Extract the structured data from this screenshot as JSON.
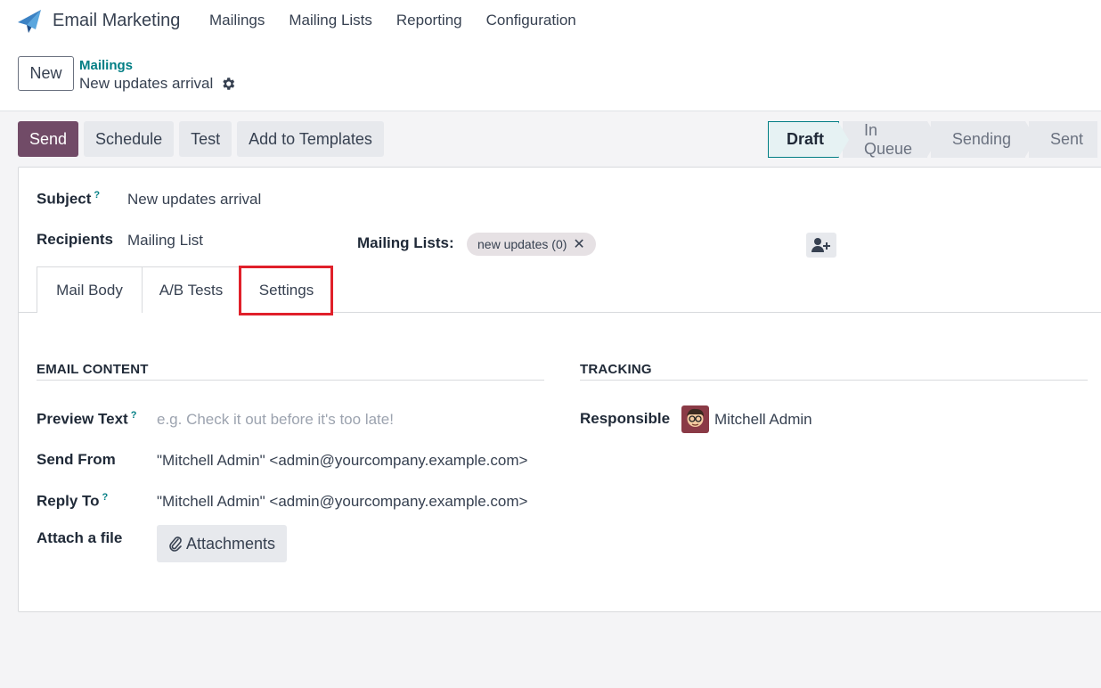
{
  "app": {
    "title": "Email Marketing",
    "menu": [
      "Mailings",
      "Mailing Lists",
      "Reporting",
      "Configuration"
    ]
  },
  "control": {
    "new_label": "New",
    "breadcrumb_parent": "Mailings",
    "breadcrumb_current": "New updates arrival"
  },
  "actions": {
    "send": "Send",
    "schedule": "Schedule",
    "test": "Test",
    "add_to_templates": "Add to Templates"
  },
  "status": {
    "stages": [
      "Draft",
      "In Queue",
      "Sending",
      "Sent"
    ],
    "active": "Draft"
  },
  "form": {
    "subject_label": "Subject",
    "subject_value": "New updates arrival",
    "recipients_label": "Recipients",
    "recipients_value": "Mailing List",
    "mailing_lists_label": "Mailing Lists:",
    "mailing_list_tag": "new updates (0)"
  },
  "tabs": [
    "Mail Body",
    "A/B Tests",
    "Settings"
  ],
  "settings": {
    "email_content_title": "EMAIL CONTENT",
    "tracking_title": "TRACKING",
    "preview_text_label": "Preview Text",
    "preview_text_placeholder": "e.g. Check it out before it's too late!",
    "send_from_label": "Send From",
    "send_from_value": "\"Mitchell Admin\" <admin@yourcompany.example.com>",
    "reply_to_label": "Reply To",
    "reply_to_value": "\"Mitchell Admin\" <admin@yourcompany.example.com>",
    "attach_label": "Attach a file",
    "attachments_button": "Attachments",
    "responsible_label": "Responsible",
    "responsible_value": "Mitchell Admin"
  },
  "colors": {
    "primary": "#714b67",
    "link": "#017e84",
    "highlight": "#e0202a"
  }
}
